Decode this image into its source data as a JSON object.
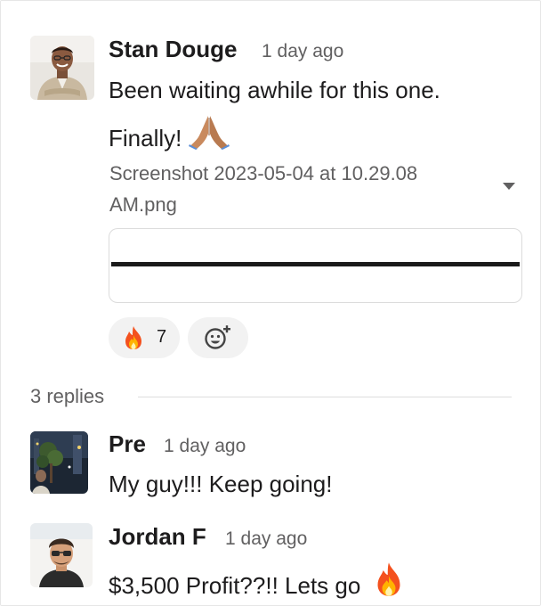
{
  "parent_message": {
    "author": "Stan Douge",
    "timestamp": "1 day ago",
    "text_line1": "Been waiting awhile for this one.",
    "text_line2": "Finally!",
    "text_emoji": "folded-hands-emoji",
    "attachment": {
      "filename": "Screenshot 2023-05-04 at 10.29.08 AM.png",
      "menu_icon": "caret-down-icon"
    },
    "reactions": [
      {
        "emoji": "fire-emoji",
        "count": "7"
      }
    ],
    "add_reaction_icon": "add-reaction-icon"
  },
  "thread": {
    "replies_label": "3 replies",
    "replies": [
      {
        "author": "Pre",
        "timestamp": "1 day ago",
        "text": "My guy!!! Keep going!"
      },
      {
        "author": "Jordan F",
        "timestamp": "1 day ago",
        "text": "$3,500 Profit??!! Lets go",
        "emoji": "fire-emoji"
      }
    ]
  },
  "colors": {
    "text_primary": "#1d1c1d",
    "text_secondary": "#616061",
    "pill_background": "#f2f2f2"
  }
}
